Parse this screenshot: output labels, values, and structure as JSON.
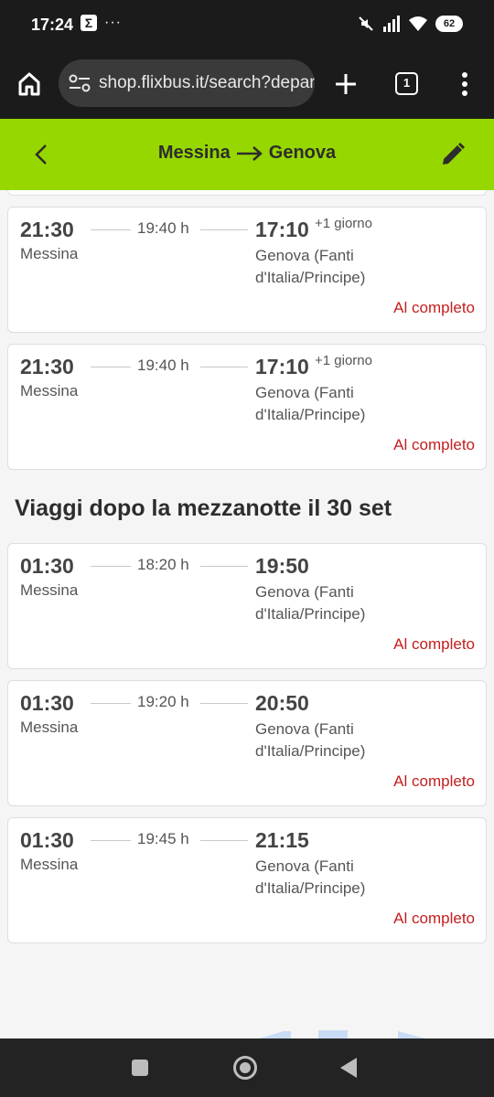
{
  "status_bar": {
    "time": "17:24",
    "notification_icon": "Σ",
    "more_dots": "···",
    "battery": "62"
  },
  "browser": {
    "url": "shop.flixbus.it/search?departure",
    "tab_count": "1"
  },
  "header": {
    "from": "Messina",
    "to": "Genova"
  },
  "trips_before": [
    {
      "dep_time": "21:30",
      "dep_city": "Messina",
      "duration": "19:40 h",
      "arr_time": "17:10",
      "next_day": "+1 giorno",
      "arr_city": "Genova (Fanti d'Italia/Principe)",
      "status": "Al completo"
    },
    {
      "dep_time": "21:30",
      "dep_city": "Messina",
      "duration": "19:40 h",
      "arr_time": "17:10",
      "next_day": "+1 giorno",
      "arr_city": "Genova (Fanti d'Italia/Principe)",
      "status": "Al completo"
    }
  ],
  "section_title": "Viaggi dopo la mezzanotte il 30 set",
  "trips_after": [
    {
      "dep_time": "01:30",
      "dep_city": "Messina",
      "duration": "18:20 h",
      "arr_time": "19:50",
      "arr_city": "Genova (Fanti d'Italia/Principe)",
      "status": "Al completo"
    },
    {
      "dep_time": "01:30",
      "dep_city": "Messina",
      "duration": "19:20 h",
      "arr_time": "20:50",
      "arr_city": "Genova (Fanti d'Italia/Principe)",
      "status": "Al completo"
    },
    {
      "dep_time": "01:30",
      "dep_city": "Messina",
      "duration": "19:45 h",
      "arr_time": "21:15",
      "arr_city": "Genova (Fanti d'Italia/Principe)",
      "status": "Al completo"
    }
  ],
  "colors": {
    "brand_green": "#97d700",
    "sold_out_red": "#c41e1e"
  }
}
